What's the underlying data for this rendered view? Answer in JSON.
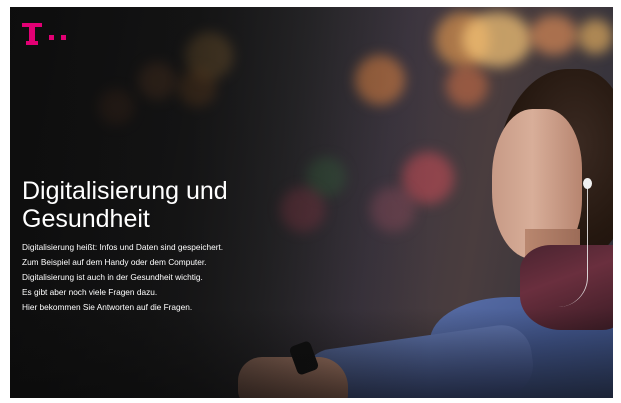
{
  "logo": {
    "name": "telekom-logo-icon",
    "color": "#e20074"
  },
  "hero": {
    "title": "Digitalisierung und Gesundheit",
    "lines": [
      "Digitalisierung heißt: Infos und Daten sind gespeichert.",
      "Zum Beispiel auf dem Handy oder dem Computer.",
      "Digitalisierung ist auch in der Gesundheit wichtig.",
      "Es gibt aber noch viele Fragen dazu.",
      "Hier bekommen Sie Antworten auf die Fragen."
    ]
  },
  "colors": {
    "brand": "#e20074",
    "text": "#ffffff",
    "background": "#1f1f20"
  },
  "image": {
    "subject": "woman-with-earphones-checking-smartwatch"
  }
}
